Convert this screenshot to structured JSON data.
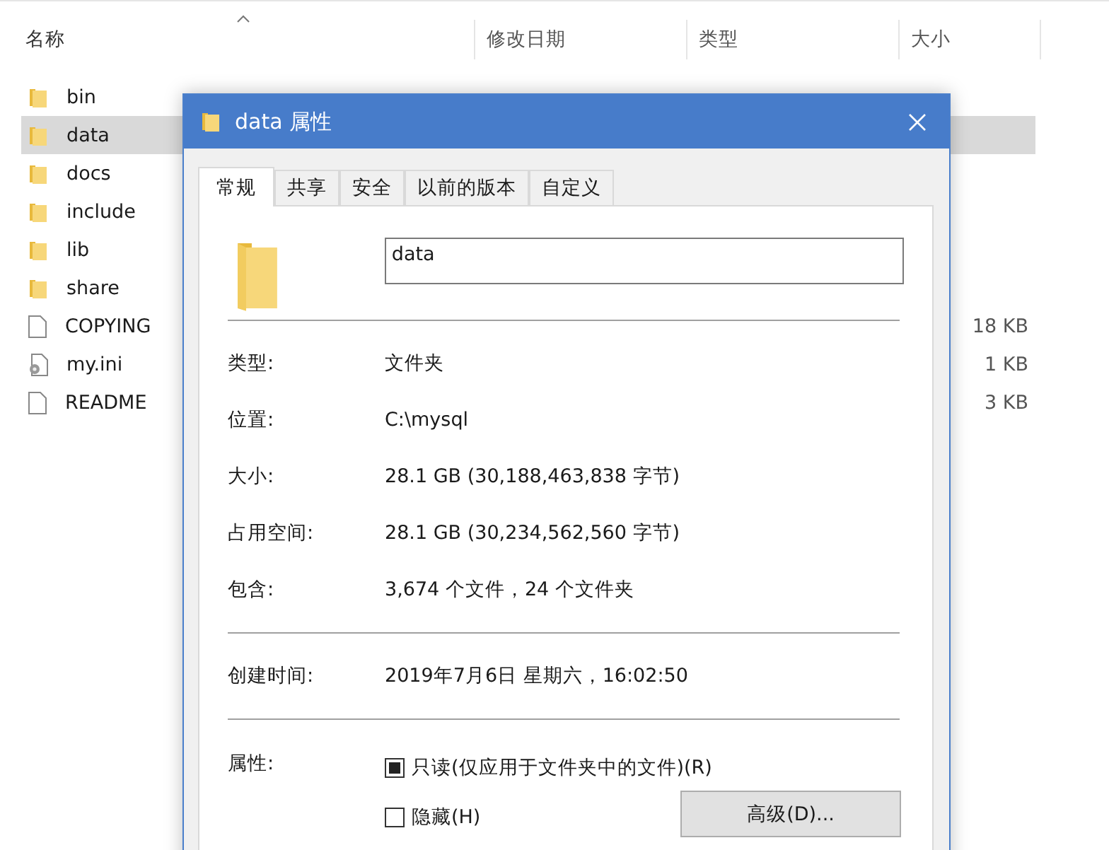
{
  "explorer": {
    "columns": [
      {
        "label": "名称",
        "sorted": true
      },
      {
        "label": "修改日期",
        "sorted": false
      },
      {
        "label": "类型",
        "sorted": false
      },
      {
        "label": "大小",
        "sorted": false
      }
    ],
    "rows": [
      {
        "name": "bin",
        "kind": "folder",
        "size": "",
        "selected": false
      },
      {
        "name": "data",
        "kind": "folder",
        "size": "",
        "selected": true
      },
      {
        "name": "docs",
        "kind": "folder",
        "size": "",
        "selected": false
      },
      {
        "name": "include",
        "kind": "folder",
        "size": "",
        "selected": false
      },
      {
        "name": "lib",
        "kind": "folder",
        "size": "",
        "selected": false
      },
      {
        "name": "share",
        "kind": "folder",
        "size": "",
        "selected": false
      },
      {
        "name": "COPYING",
        "kind": "file",
        "size": "18 KB",
        "selected": false
      },
      {
        "name": "my.ini",
        "kind": "config",
        "size": "1 KB",
        "selected": false
      },
      {
        "name": "README",
        "kind": "file",
        "size": "3 KB",
        "selected": false
      }
    ]
  },
  "dialog": {
    "title": "data 属性",
    "tabs": [
      {
        "label": "常规",
        "selected": true
      },
      {
        "label": "共享",
        "selected": false
      },
      {
        "label": "安全",
        "selected": false
      },
      {
        "label": "以前的版本",
        "selected": false
      },
      {
        "label": "自定义",
        "selected": false
      }
    ],
    "name_field": {
      "value": "data"
    },
    "groups": [
      [
        {
          "label": "类型:",
          "value": "文件夹"
        },
        {
          "label": "位置:",
          "value": "C:\\mysql"
        },
        {
          "label": "大小:",
          "value": "28.1 GB (30,188,463,838 字节)"
        },
        {
          "label": "占用空间:",
          "value": "28.1 GB (30,234,562,560 字节)"
        },
        {
          "label": "包含:",
          "value": "3,674 个文件，24 个文件夹"
        }
      ],
      [
        {
          "label": "创建时间:",
          "value": "2019年7月6日 星期六，16:02:50"
        }
      ]
    ],
    "attributes": {
      "label": "属性:",
      "options": [
        {
          "label": "只读(仅应用于文件夹中的文件)(R)",
          "checked": false,
          "mixed": true
        },
        {
          "label": "隐藏(H)",
          "checked": false,
          "mixed": false
        }
      ],
      "button": "高级(D)..."
    }
  }
}
